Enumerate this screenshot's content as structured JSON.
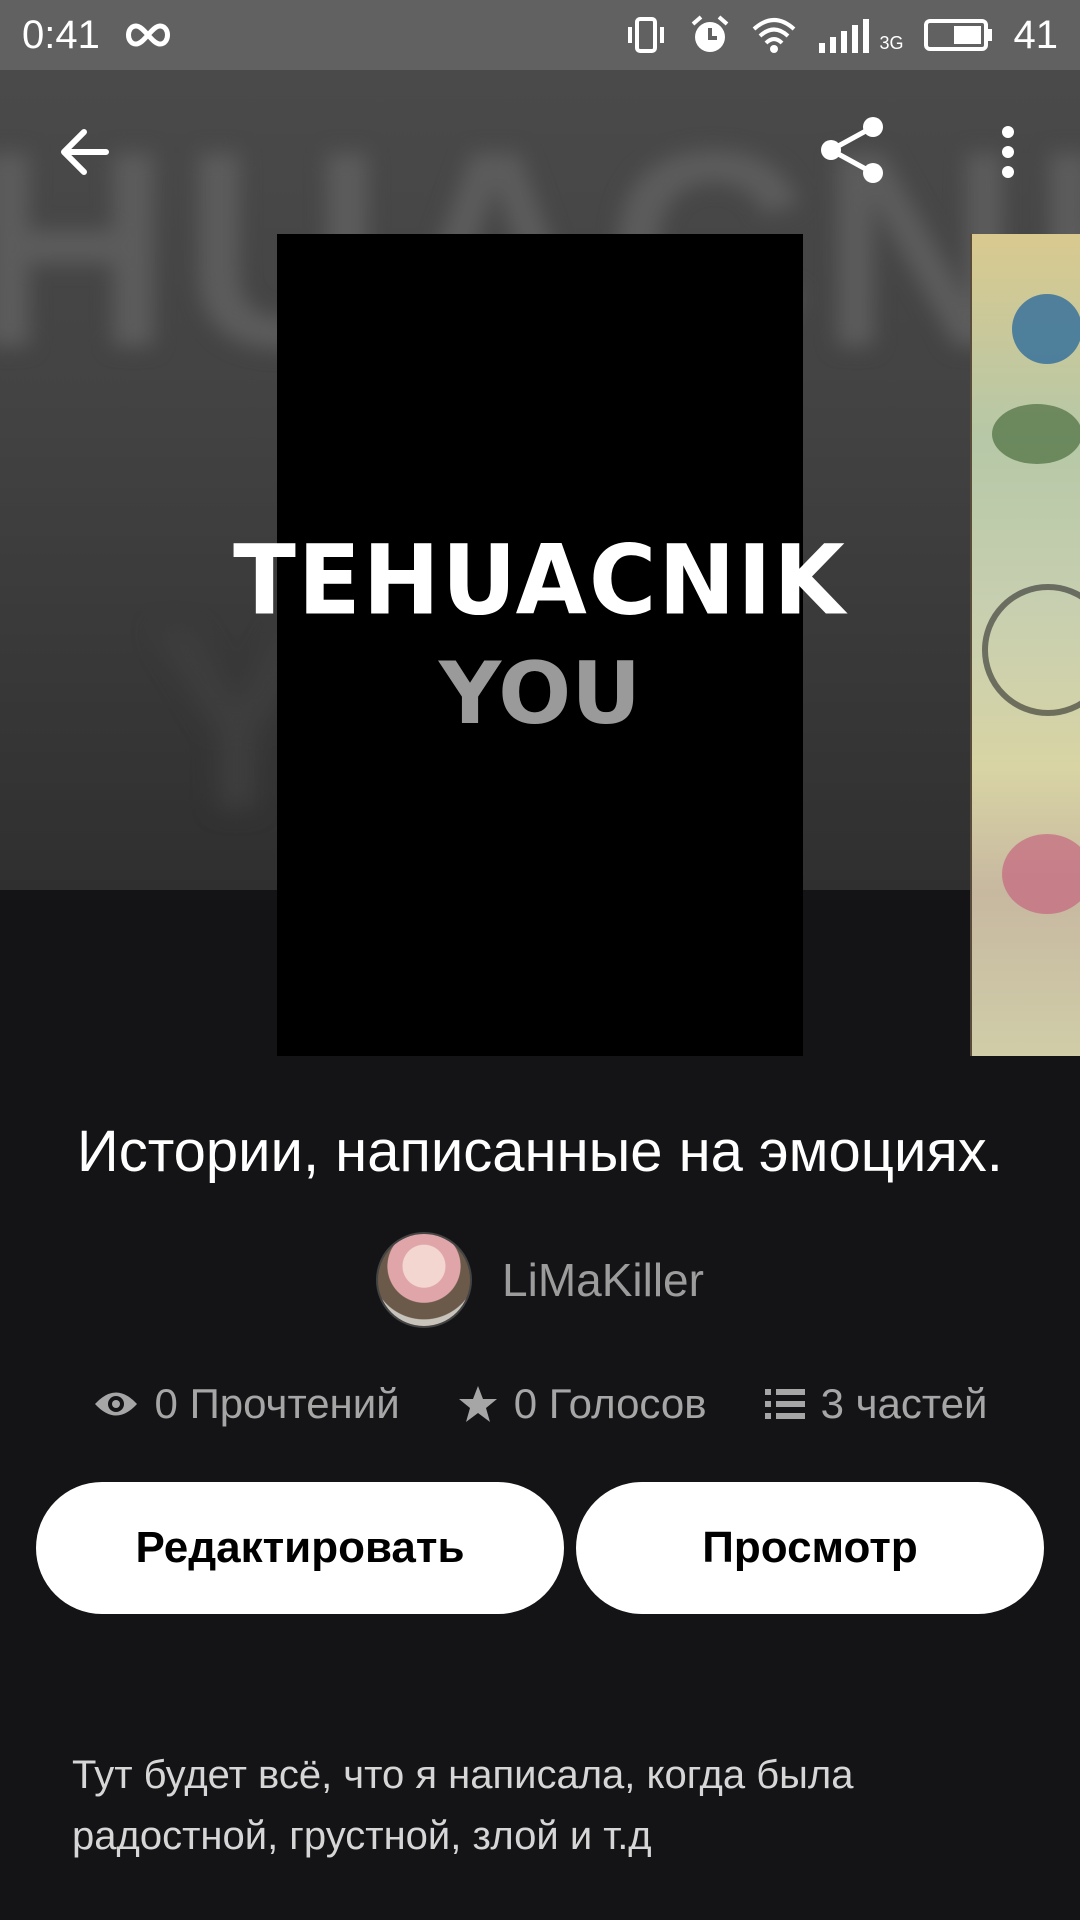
{
  "status_bar": {
    "time": "0:41",
    "network_type": "3G",
    "battery_level": "41",
    "icons": [
      "infinity-icon",
      "vibrate-icon",
      "alarm-icon",
      "wifi-icon",
      "signal-icon",
      "battery-icon"
    ]
  },
  "toolbar": {
    "back_icon": "arrow-left-icon",
    "share_icon": "share-icon",
    "menu_icon": "more-vertical-icon"
  },
  "cover": {
    "title_text": "TEHUACNIK",
    "subtitle_text": "YOU"
  },
  "story": {
    "title": "Истории, написанные на эмоциях.",
    "author": "LiMaKiller",
    "reads": "0 Прочтений",
    "votes": "0 Голосов",
    "parts": "3 частей",
    "description": "Тут будет всё, что я написала, когда была радостной, грустной, злой и т.д"
  },
  "actions": {
    "edit_label": "Редактировать",
    "view_label": "Просмотр"
  },
  "colors": {
    "background": "#141316",
    "status_bar": "#616161",
    "button_bg": "#ffffff",
    "muted_text": "#a6a6a6"
  }
}
